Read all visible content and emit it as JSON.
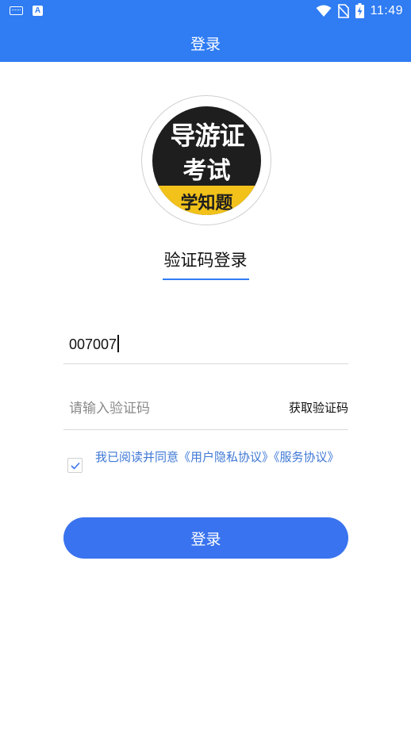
{
  "status_bar": {
    "time": "11:49",
    "icons": [
      "keyboard-icon",
      "a-notification-icon",
      "wifi-icon",
      "no-sim-icon",
      "battery-charging-icon"
    ],
    "a_glyph": "A"
  },
  "app_bar": {
    "title": "登录"
  },
  "logo": {
    "line1": "导游证",
    "line2": "考试",
    "line3": "学知题"
  },
  "login_mode": {
    "label": "验证码登录"
  },
  "phone": {
    "value": "007007"
  },
  "code": {
    "placeholder": "请输入验证码",
    "get_code_label": "获取验证码"
  },
  "agreement": {
    "checked": true,
    "text": "我已阅读并同意《用户隐私协议》《服务协议》"
  },
  "login_button": {
    "label": "登录"
  },
  "colors": {
    "primary": "#2f7cf3",
    "button": "#3a73ef",
    "link": "#3f78d6",
    "logo_yellow": "#f2c21b"
  }
}
